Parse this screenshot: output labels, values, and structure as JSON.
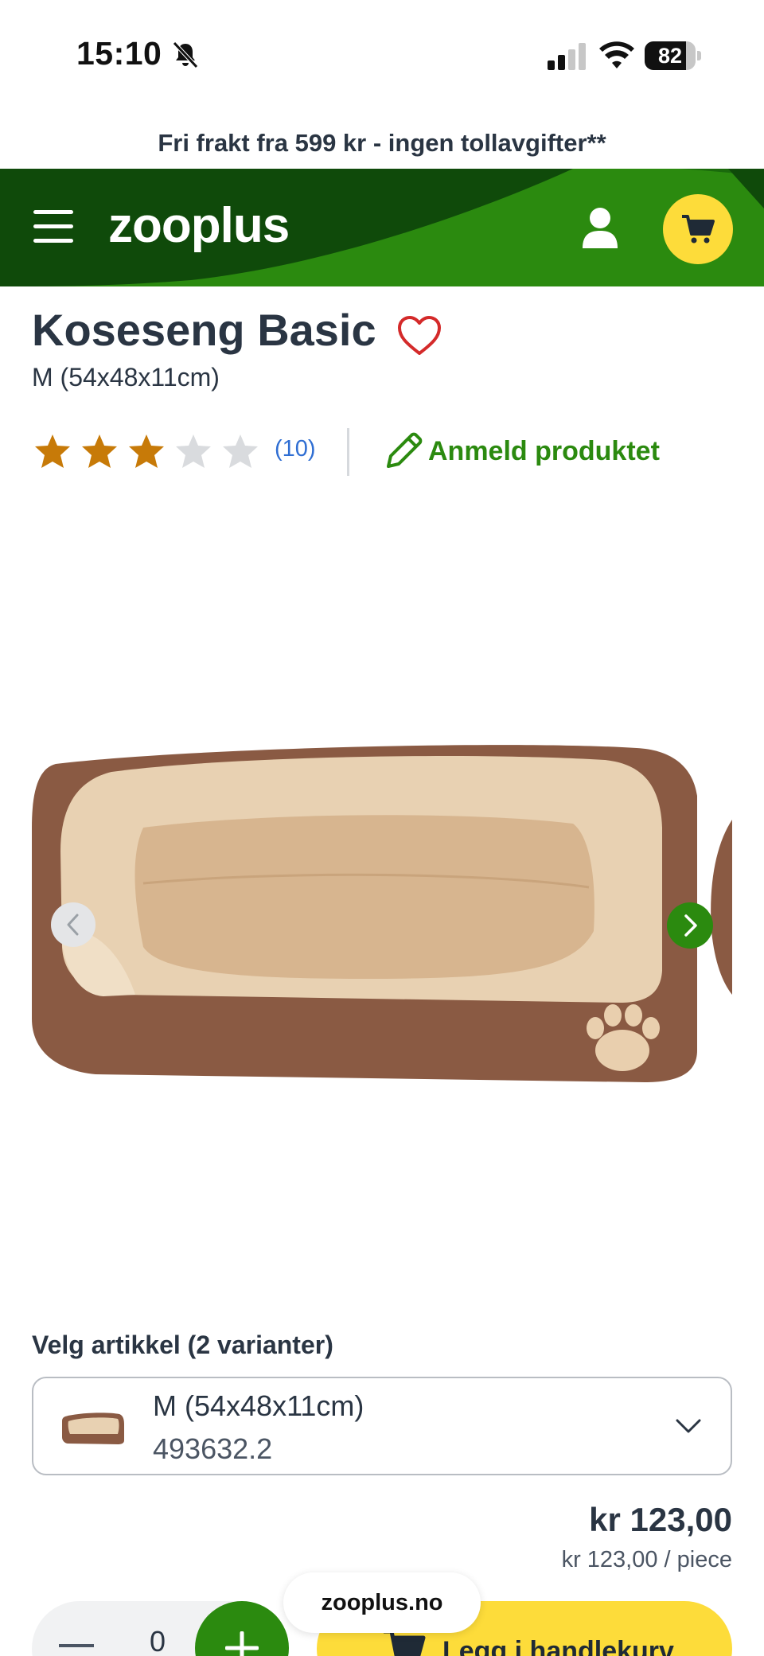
{
  "status_bar": {
    "time": "15:10",
    "battery": "82",
    "battery_level": 0.82
  },
  "promo": {
    "text": "Fri frakt fra 599 kr - ingen tollavgifter**"
  },
  "header": {
    "logo": "zooplus"
  },
  "product": {
    "title": "Koseseng Basic",
    "subtitle": "M (54x48x11cm)",
    "rating": 3,
    "rating_max": 5,
    "review_count": "(10)",
    "review_link": "Anmeld produktet"
  },
  "variants": {
    "heading": "Velg artikkel (2 varianter)",
    "selected_name": "M (54x48x11cm)",
    "selected_code": "493632.2"
  },
  "pricing": {
    "price": "kr 123,00",
    "unit_price": "kr 123,00 / piece"
  },
  "cart": {
    "quantity": "0",
    "add_label": "Legg i handlekurv"
  },
  "browser": {
    "url": "zooplus.no"
  },
  "colors": {
    "brand_green": "#2b8a0f",
    "dark_green": "#0f4a0a",
    "cart_yellow": "#fddc3a",
    "star_orange": "#c77a08",
    "link_blue": "#2f6ed3"
  }
}
